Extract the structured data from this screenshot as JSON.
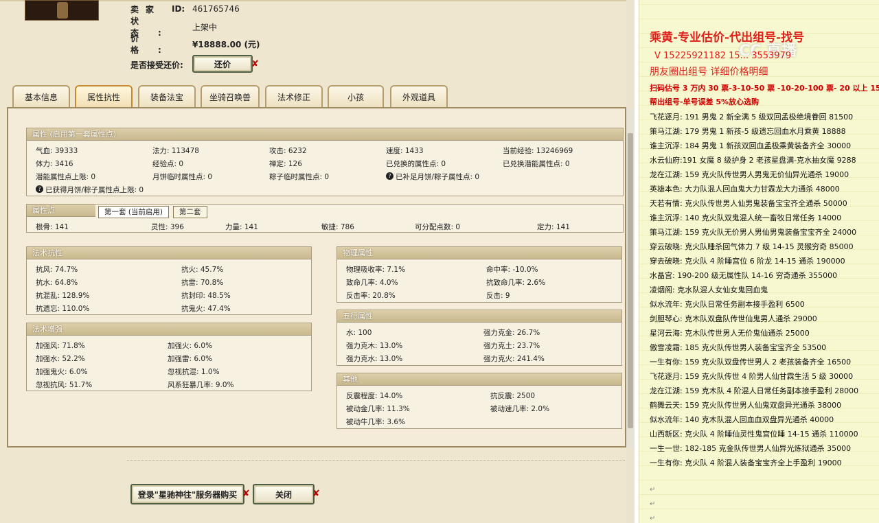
{
  "seller": {
    "id_label": "卖家",
    "id_prefix": "ID:",
    "id_value": "461765746",
    "status_label": "状态:",
    "status_value": "上架中",
    "price_label": "价格:",
    "price_value": "¥18888.00 (元)",
    "bargain_label": "是否接受还价:",
    "bargain_button": "还价"
  },
  "tabs": [
    {
      "label": "基本信息"
    },
    {
      "label": "属性抗性"
    },
    {
      "label": "装备法宝"
    },
    {
      "label": "坐骑召唤兽"
    },
    {
      "label": "法术修正"
    },
    {
      "label": "小孩"
    },
    {
      "label": "外观道具"
    }
  ],
  "attrs": {
    "title": "属性 (启用第一套属性点)",
    "rows": [
      [
        "气血: 39333",
        "法力: 113478",
        "攻击: 6232",
        "速度: 1433",
        "当前经验: 13246969"
      ],
      [
        "体力: 3416",
        "经验点: 0",
        "禅定: 126",
        "已兑换的属性点: 0",
        "已兑换潜能属性点: 0"
      ],
      [
        "潜能属性点上限: 0",
        "月饼临时属性点: 0",
        "粽子临时属性点: 0",
        "已补足月饼/粽子属性点: 0",
        ""
      ]
    ],
    "note": "已获得月饼/粽子属性点上限: 0"
  },
  "points": {
    "title": "属性点",
    "tab1": "第一套 (当前启用)",
    "tab2": "第二套",
    "row": [
      "根骨: 141",
      "灵性: 396",
      "力量: 141",
      "敏捷: 786",
      "可分配点数: 0",
      "定力: 141"
    ]
  },
  "magic_resist": {
    "title": "法术抗性",
    "rows": [
      [
        "抗风: 74.7%",
        "抗火: 45.7%"
      ],
      [
        "抗水: 64.8%",
        "抗雷: 70.8%"
      ],
      [
        "抗混乱: 128.9%",
        "抗封印: 48.5%"
      ],
      [
        "抗遗忘: 110.0%",
        "抗鬼火: 47.4%"
      ]
    ]
  },
  "magic_boost": {
    "title": "法术增强",
    "rows": [
      [
        "加强风: 71.8%",
        "加强火: 6.0%"
      ],
      [
        "加强水: 52.2%",
        "加强雷: 6.0%"
      ],
      [
        "加强鬼火: 6.0%",
        "忽视抗混: 1.0%"
      ],
      [
        "忽视抗风: 51.7%",
        "风系狂暴几率: 9.0%"
      ]
    ]
  },
  "physical": {
    "title": "物理属性",
    "rows": [
      [
        "物理吸收率: 7.1%",
        "命中率: -10.0%"
      ],
      [
        "致命几率: 4.0%",
        "抗致命几率: 2.6%"
      ],
      [
        "反击率: 20.8%",
        "反击: 9"
      ]
    ]
  },
  "elements": {
    "title": "五行属性",
    "rows": [
      [
        "水: 100",
        "强力克金: 26.7%"
      ],
      [
        "强力克木: 13.0%",
        "强力克土: 23.7%"
      ],
      [
        "强力克水: 13.0%",
        "强力克火: 241.4%"
      ]
    ]
  },
  "other": {
    "title": "其他",
    "rows": [
      [
        "反震程度: 14.0%",
        "抗反震: 2500"
      ],
      [
        "被动金几率: 11.3%",
        "被动速几率: 2.0%"
      ],
      [
        "被动牛几率: 3.6%",
        ""
      ]
    ]
  },
  "bottom": {
    "buy_button": "登录\"星驰神往\"服务器购买",
    "close_button": "关闭"
  },
  "notes": {
    "title": "乘黄-专业估价-代出组号-找号",
    "phone": "V 15225921182  15... 3553979",
    "sub": "朋友圈出组号    详细价格明细",
    "red1": "扫码估号 3 万内 30 票-3-10-50 票 -10-20-100 票- 20 以上 150",
    "red2": "帮出组号-单号误差 5%放心选购",
    "watermark": "CC 直播",
    "lines": [
      "飞花逐月: 191 男鬼 2 新全满 5 级双回孟极绝境眷回 81500",
      "策马江湖: 179 男鬼 1 新孩-5 级遗忘回血水月乘黄 18888",
      "谁主沉浮: 184 男鬼 1 新孩双回血孟极乘黄装备齐全 30000",
      "水云仙府:191 女魔 8 级护身 2 老孩星盘满-克水抽女魔 9288",
      "龙在江湖: 159 克火队传世男人男鬼无价仙异光通杀 19000",
      "英雄本色: 大力队混人回血鬼大力甘霖龙大力通杀 48000",
      "天若有情: 克火队传世男人仙男鬼装备宝宝齐全通杀 50000",
      "谁主沉浮: 140 克火队双鬼混人统一畜牧日常任务 14000",
      "策马江湖: 159 克火队无价男人男仙男鬼装备宝宝齐全 24000",
      "穿云破晓: 克火队睡杀回气体力 7 级 14-15 灵猴穷奇 85000",
      "穿去破晓: 克火队 4 阶睡宫位 6 阶龙 14-15 通杀 190000",
      "水晶宫: 190-200 级无属性队 14-16 穷奇通杀 355000",
      "凌烟阁: 克水队混人女仙女鬼回血鬼",
      "似水流年: 克火队日常任务副本接手盈利 6500",
      "剑胆琴心: 克木队双盘队传世仙鬼男人通杀 29000",
      "星河云海: 克木队传世男人无价鬼仙通杀 25000",
      "傲雪凌霜: 185 克火队传世男人装备宝宝齐全 53500",
      "一生有你: 159 克火队双盘传世男人 2 老孩装备齐全 16500",
      "飞花逐月: 159 克火队传世 4 阶男人仙甘霖生活 5 级 30000",
      "龙在江湖: 159 克木队 4 阶混人日常任务副本接手盈利 28000",
      "鹤舞云天: 159 克火队传世男人仙鬼双盘异光通杀 38000",
      "似水流年: 140 克木队混人回血血双盘异光通杀 40000",
      "山西新区: 克火队 4 阶睡仙灵性鬼宫位睡 14-15 通杀 110000",
      "一生一世: 182-185 克金队传世男人仙异光炼狱通杀 35000",
      "一生有你: 克火队 4 阶混人装备宝宝齐全上手盈利 19000"
    ]
  }
}
